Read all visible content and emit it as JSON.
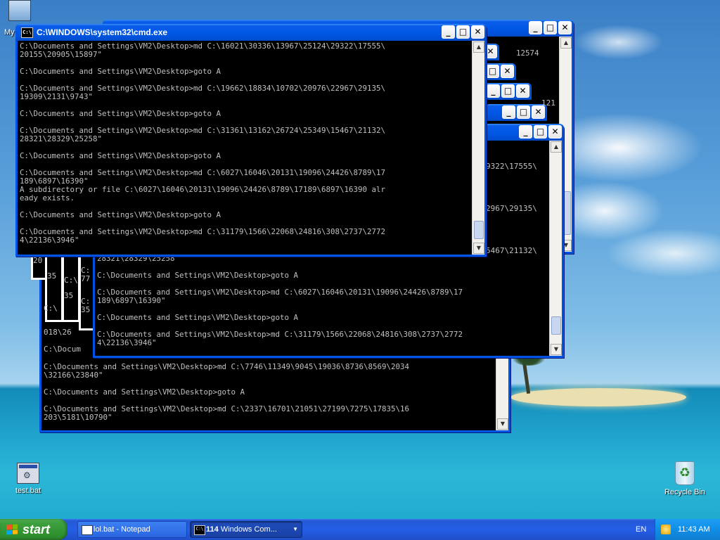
{
  "desktop": {
    "icons": {
      "my_computer": "My",
      "test_bat": "test.bat",
      "recycle_bin": "Recycle Bin"
    }
  },
  "windows": {
    "main": {
      "title": "C:\\WINDOWS\\system32\\cmd.exe",
      "icon_text": "C:\\",
      "console": "C:\\Documents and Settings\\VM2\\Desktop>md C:\\16021\\30336\\13967\\25124\\29322\\17555\\\n20155\\20905\\15897\"\n\nC:\\Documents and Settings\\VM2\\Desktop>goto A\n\nC:\\Documents and Settings\\VM2\\Desktop>md C:\\19662\\18834\\10702\\20976\\22967\\29135\\\n19309\\2131\\9743\"\n\nC:\\Documents and Settings\\VM2\\Desktop>goto A\n\nC:\\Documents and Settings\\VM2\\Desktop>md C:\\31361\\13162\\26724\\25349\\15467\\21132\\\n28321\\28329\\25258\"\n\nC:\\Documents and Settings\\VM2\\Desktop>goto A\n\nC:\\Documents and Settings\\VM2\\Desktop>md C:\\6027\\16046\\20131\\19096\\24426\\8789\\17\n189\\6897\\16390\"\nA subdirectory or file C:\\6027\\16046\\20131\\19096\\24426\\8789\\17189\\6897\\16390 alr\neady exists.\n\nC:\\Documents and Settings\\VM2\\Desktop>goto A\n\nC:\\Documents and Settings\\VM2\\Desktop>md C:\\31179\\1566\\22068\\24816\\308\\2737\\2772\n4\\22136\\3946\""
    },
    "second": {
      "console": "28321\\28329\\25258\n\nC:\\Documents and Settings\\VM2\\Desktop>goto A\n\nC:\\Documents and Settings\\VM2\\Desktop>md C:\\6027\\16046\\20131\\19096\\24426\\8789\\17\n189\\6897\\16390\"\n\nC:\\Documents and Settings\\VM2\\Desktop>goto A\n\nC:\\Documents and Settings\\VM2\\Desktop>md C:\\31179\\1566\\22068\\24816\\308\\2737\\2772\n4\\22136\\3946\""
    },
    "third": {
      "console": "C:\\Documents and Settings\\VM2\\Desktop>md C:\\7746\\11349\\9045\\19036\\8736\\8569\\2034\n\\32166\\23840\"\n\nC:\\Documents and Settings\\VM2\\Desktop>goto A\n\nC:\\Documents and Settings\\VM2\\Desktop>md C:\\2337\\16701\\21051\\27199\\7275\\17835\\16\n203\\5181\\10790\""
    },
    "fragments": {
      "a": "12574",
      "b": "9322\\17555\\",
      "c": "2967\\29135\\",
      "d": "5467\\21132\\",
      "e": "121",
      "f": "20",
      "g": "018\\26",
      "h": "C:\\Docum",
      "i": "C:\\",
      "j": "35",
      "k": "77",
      "l": "C:"
    }
  },
  "taskbar": {
    "start_label": "start",
    "tasks": [
      {
        "label": "lol.bat - Notepad"
      },
      {
        "count": "114",
        "label": "Windows Com..."
      }
    ],
    "language": "EN",
    "clock": "11:43 AM"
  },
  "buttons": {
    "minimize": "_",
    "maximize": "□",
    "close": "✕"
  },
  "colors": {
    "titlebar": "#0058e6",
    "console_bg": "#000000",
    "console_fg": "#c0c0c0",
    "start_green": "#3c9f3c"
  }
}
